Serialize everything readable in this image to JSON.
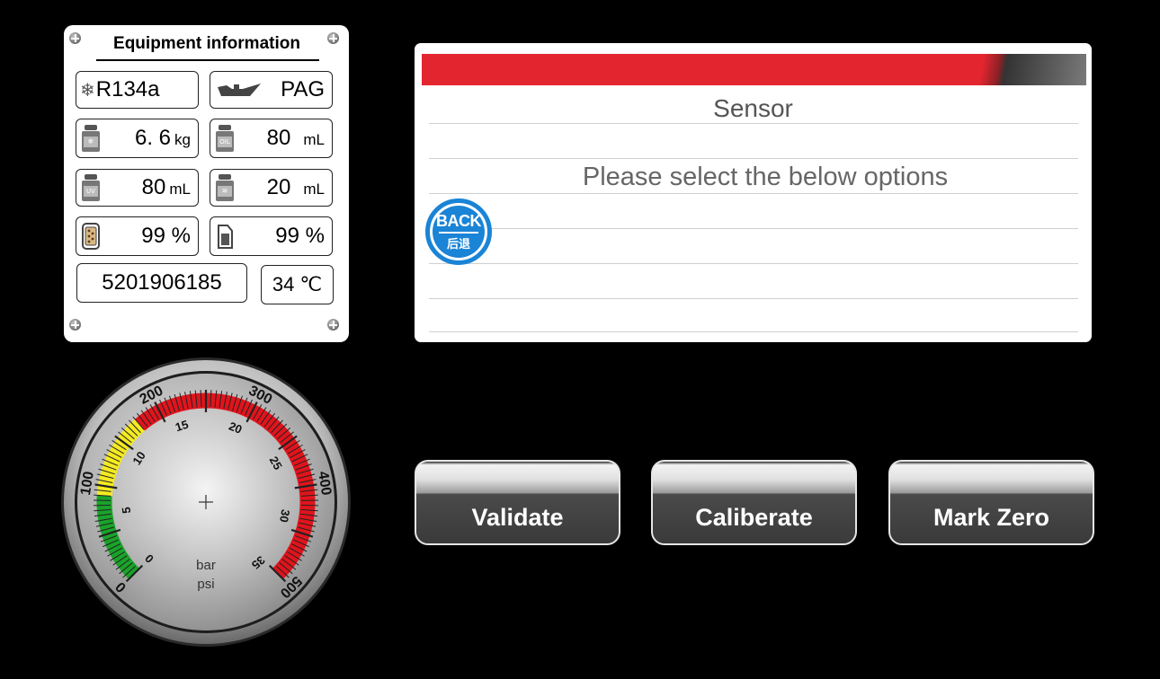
{
  "equipment": {
    "title": "Equipment information",
    "refrigerant": "R134a",
    "oil_type": "PAG",
    "refrigerant_amount": "6. 6",
    "refrigerant_unit": "kg",
    "oil_amount": "80",
    "oil_unit": "mL",
    "uv_amount": "80",
    "uv_unit": "mL",
    "waste_oil_amount": "20",
    "waste_oil_unit": "mL",
    "filter_percent": "99 %",
    "tank_percent": "99 %",
    "serial_number": "5201906185",
    "temperature": "34 ℃",
    "bottle_labels": {
      "refrigerant": "❄",
      "oil": "OIL",
      "uv": "UV",
      "waste": "≋"
    }
  },
  "dialog": {
    "title": "Sensor",
    "message": "Please select the below options",
    "back_label_en": "BACK",
    "back_label_cn": "后退"
  },
  "buttons": {
    "validate": "Validate",
    "calibrate": "Caliberate",
    "mark_zero": "Mark Zero"
  },
  "gauge": {
    "units_inner": "bar",
    "units_outer": "psi",
    "psi_labels": [
      "0",
      "100",
      "200",
      "300",
      "400",
      "500"
    ],
    "bar_labels": [
      "0",
      "5",
      "10",
      "15",
      "20",
      "25",
      "30",
      "35"
    ],
    "psi_max": 500,
    "zones": [
      {
        "from": 0,
        "to": 90,
        "color": "#1aa32a"
      },
      {
        "from": 90,
        "to": 175,
        "color": "#f4ea22"
      },
      {
        "from": 175,
        "to": 500,
        "color": "#e0141c"
      }
    ]
  },
  "colors": {
    "dialog_bar": "#e3252f",
    "back_button": "#1a84d6",
    "background": "#000000"
  }
}
